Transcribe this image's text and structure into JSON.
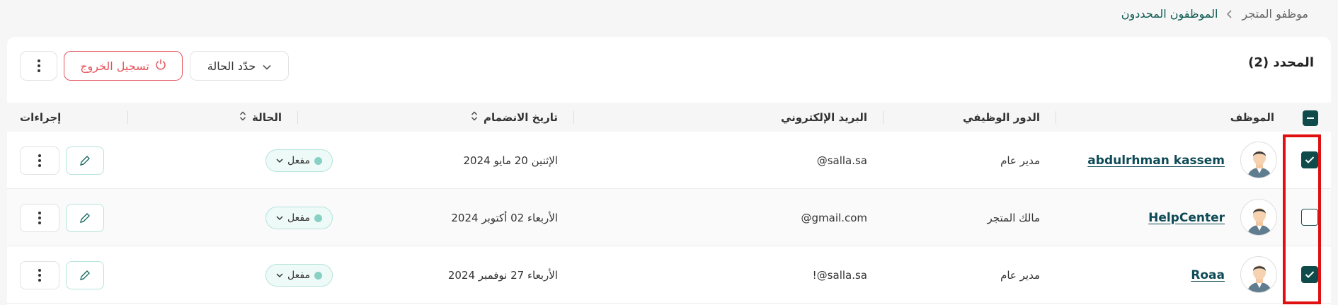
{
  "breadcrumb": {
    "parent": "موظفو المتجر",
    "current": "الموظفون المحددون"
  },
  "toolbar": {
    "title": "المحدد (2)",
    "status_select_label": "حدّد الحالة",
    "logout_label": "تسجيل الخروج",
    "more_icon": "more-vertical-icon"
  },
  "columns": {
    "employee": "الموظف",
    "role": "الدور الوظيفي",
    "email": "البريد الإلكتروني",
    "join_date": "تاريخ الانضمام",
    "status": "الحالة",
    "actions": "إجراءات"
  },
  "rows": [
    {
      "checked": true,
      "name": "abdulrhman kassem",
      "role": "مدير عام",
      "email": "@salla.sa",
      "join_date": "الإثنين 20 مايو 2024",
      "status": "مفعل"
    },
    {
      "checked": false,
      "name": "HelpCenter",
      "role": "مالك المتجر",
      "email": "@gmail.com",
      "join_date": "الأربعاء 02 أكتوبر 2024",
      "status": "مفعل"
    },
    {
      "checked": true,
      "name": "Roaa",
      "role": "مدير عام",
      "email": "!@salla.sa",
      "join_date": "الأربعاء 27 نوفمبر 2024",
      "status": "مفعل"
    }
  ],
  "colors": {
    "accent": "#0f4b4a",
    "danger": "#e4525a",
    "highlight": "#e01010",
    "status_dot": "#86d1c4"
  }
}
